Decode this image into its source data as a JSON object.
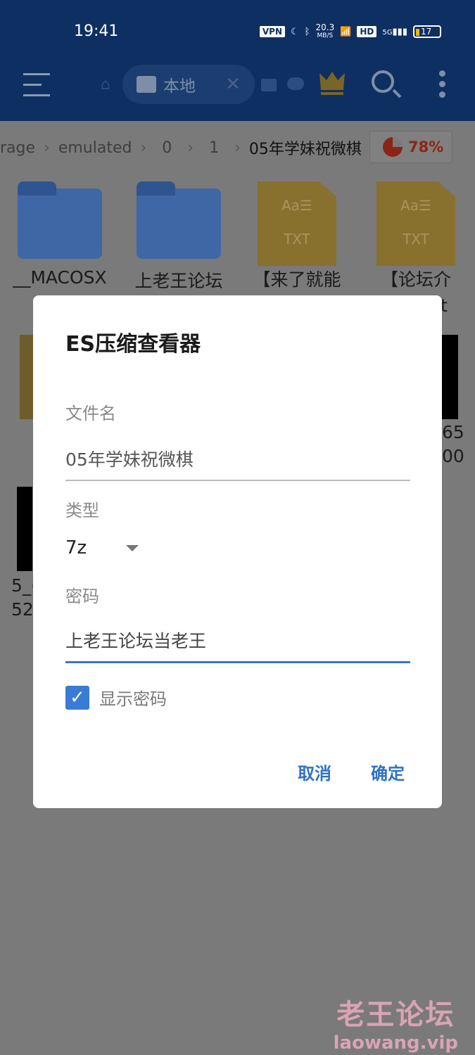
{
  "status_bar": {
    "time": "19:41",
    "vpn": "VPN",
    "speed_value": "20.3",
    "speed_unit": "MB/S",
    "hd": "HD",
    "network": "5G",
    "battery": "17"
  },
  "toolbar": {
    "tab_label": "本地",
    "icons": [
      "menu-icon",
      "home-icon",
      "sd-card-icon",
      "close-icon",
      "cloud-icon",
      "crown-icon",
      "search-icon",
      "more-icon"
    ]
  },
  "breadcrumb": {
    "items": [
      "rage",
      "emulated",
      "0",
      "1"
    ],
    "current": "05年学妹祝微棋",
    "storage_percent": "78%"
  },
  "files": [
    {
      "name": "__MACOSX",
      "type": "folder"
    },
    {
      "name": "上老王论坛",
      "type": "folder"
    },
    {
      "name": "【来了就能",
      "type": "txt",
      "icon_text": "TXT"
    },
    {
      "name": "【论坛介",
      "type": "txt",
      "icon_text": "TXT",
      "extra": "t"
    }
  ],
  "partial_texts": {
    "right_1": "65",
    "right_2": "00",
    "left_1": "5_(",
    "left_2": "52"
  },
  "dialog": {
    "title": "ES压缩查看器",
    "filename_label": "文件名",
    "filename_value": "05年学妹祝微棋",
    "type_label": "类型",
    "type_value": "7z",
    "password_label": "密码",
    "password_value": "上老王论坛当老王",
    "show_password_label": "显示密码",
    "show_password_checked": true,
    "cancel": "取消",
    "ok": "确定"
  },
  "watermark": {
    "line1": "老王论坛",
    "line2": "laowang.vip"
  },
  "colors": {
    "header": "#0e2f62",
    "accent": "#3a7bd5",
    "storage": "#8a2516"
  }
}
